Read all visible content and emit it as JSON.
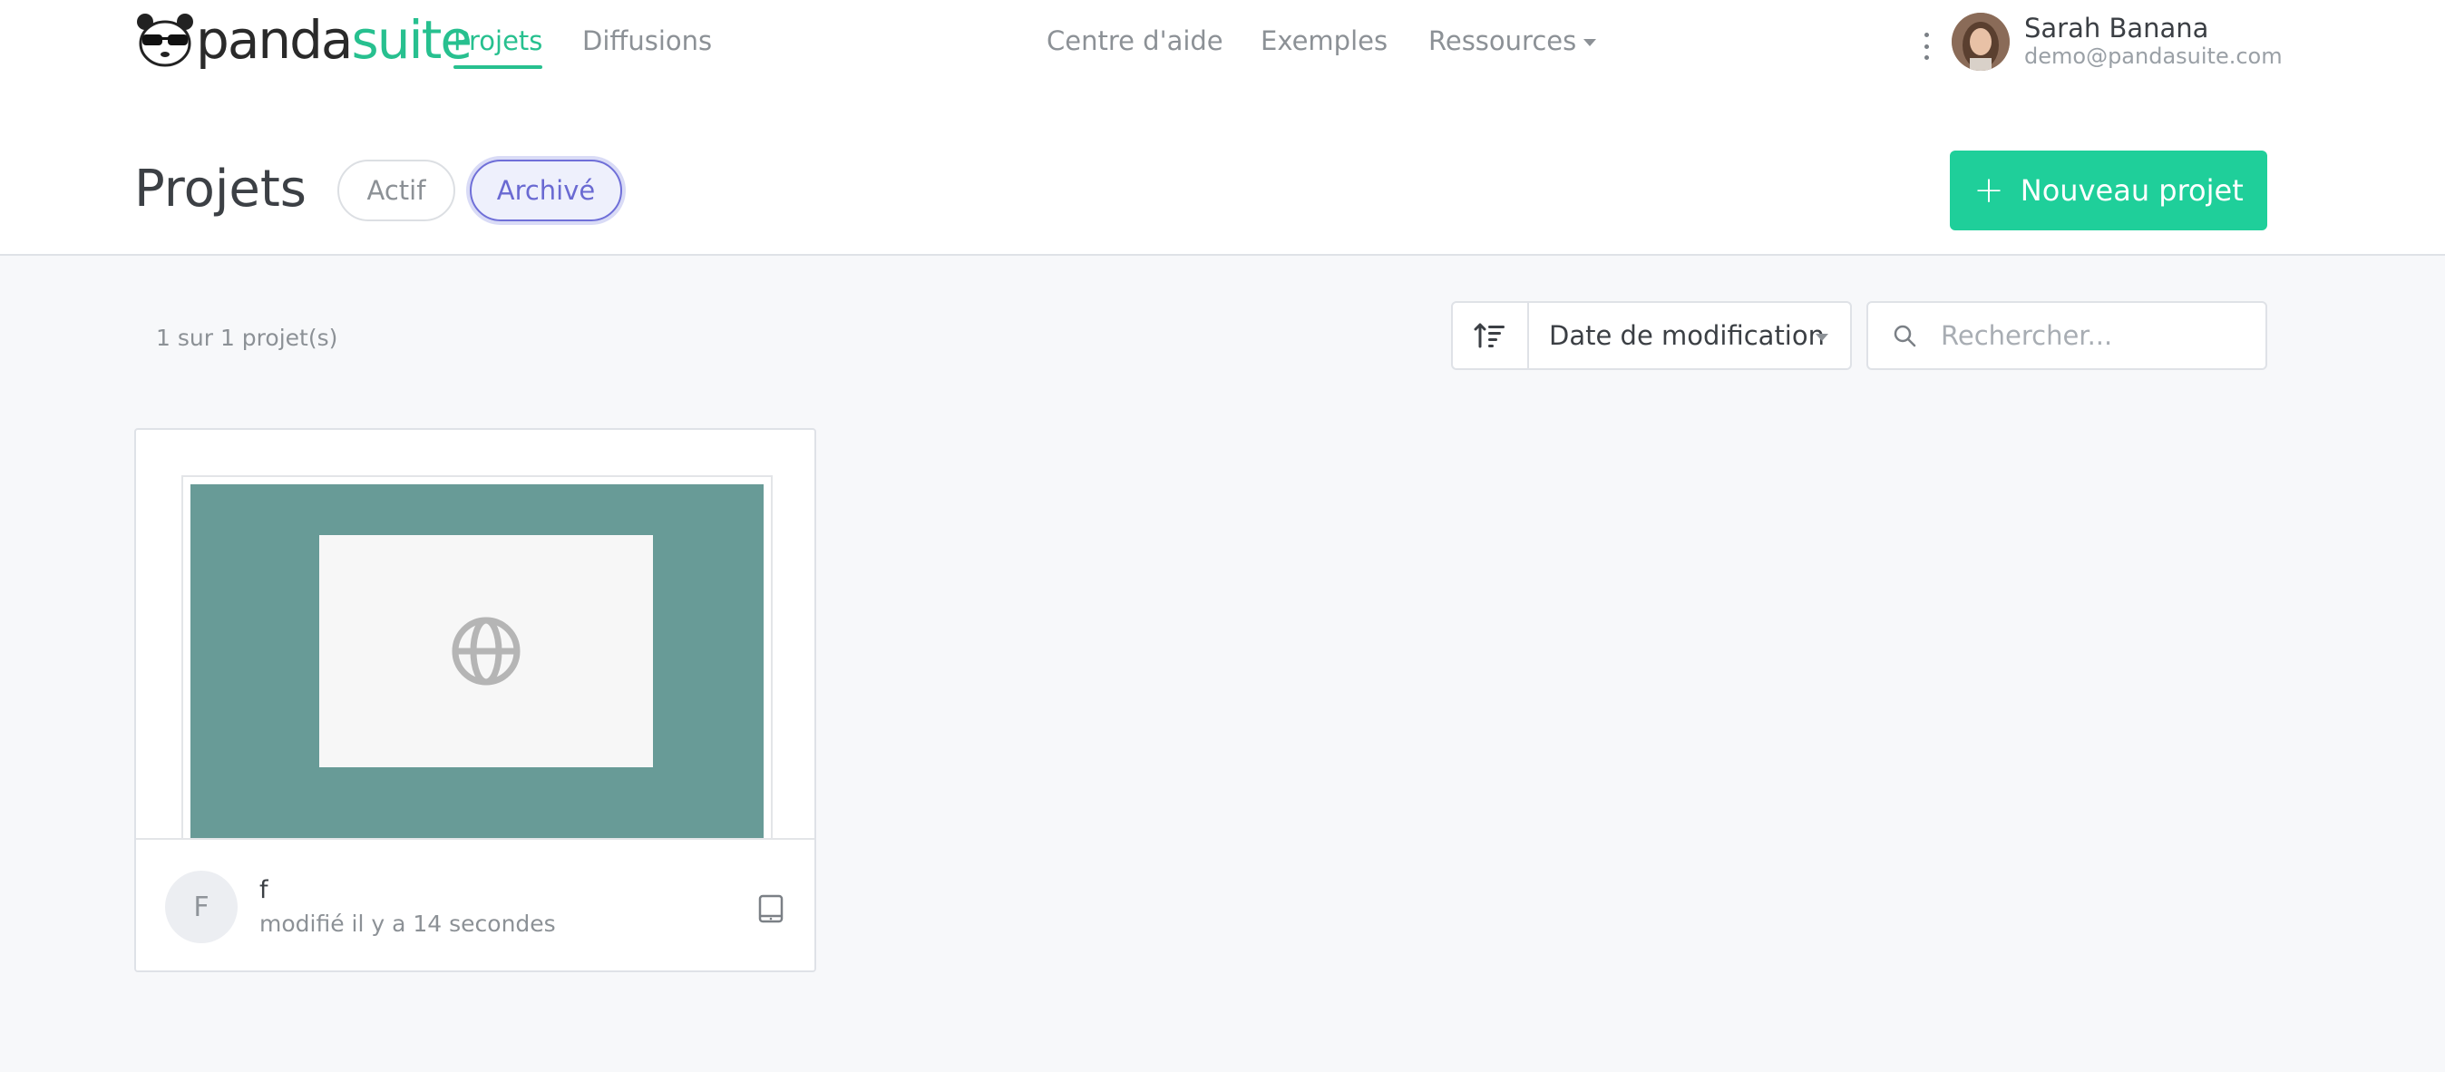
{
  "header": {
    "logo": {
      "part1": "panda",
      "part2": "suite"
    },
    "nav": {
      "projets": "Projets",
      "diffusions": "Diffusions"
    },
    "center_nav": {
      "centre_aide": "Centre d'aide",
      "exemples": "Exemples",
      "ressources": "Ressources"
    },
    "user": {
      "name": "Sarah Banana",
      "email": "demo@pandasuite.com"
    }
  },
  "page": {
    "title": "Projets",
    "filters": {
      "actif": "Actif",
      "archive": "Archivé",
      "selected": "Archivé"
    },
    "new_button": {
      "icon": "+",
      "label": "Nouveau projet"
    }
  },
  "toolbar": {
    "count": "1 sur 1 projet(s)",
    "sort_label": "Date de modification",
    "search_placeholder": "Rechercher..."
  },
  "projects": [
    {
      "initial": "F",
      "name": "f",
      "modified": "modifié il y a 14 secondes",
      "device_icon": "tablet-icon"
    }
  ],
  "colors": {
    "accent": "#27c08f",
    "button": "#1fcf9a",
    "selected_filter": "#6a6ad2",
    "thumbnail": "#689b97"
  }
}
